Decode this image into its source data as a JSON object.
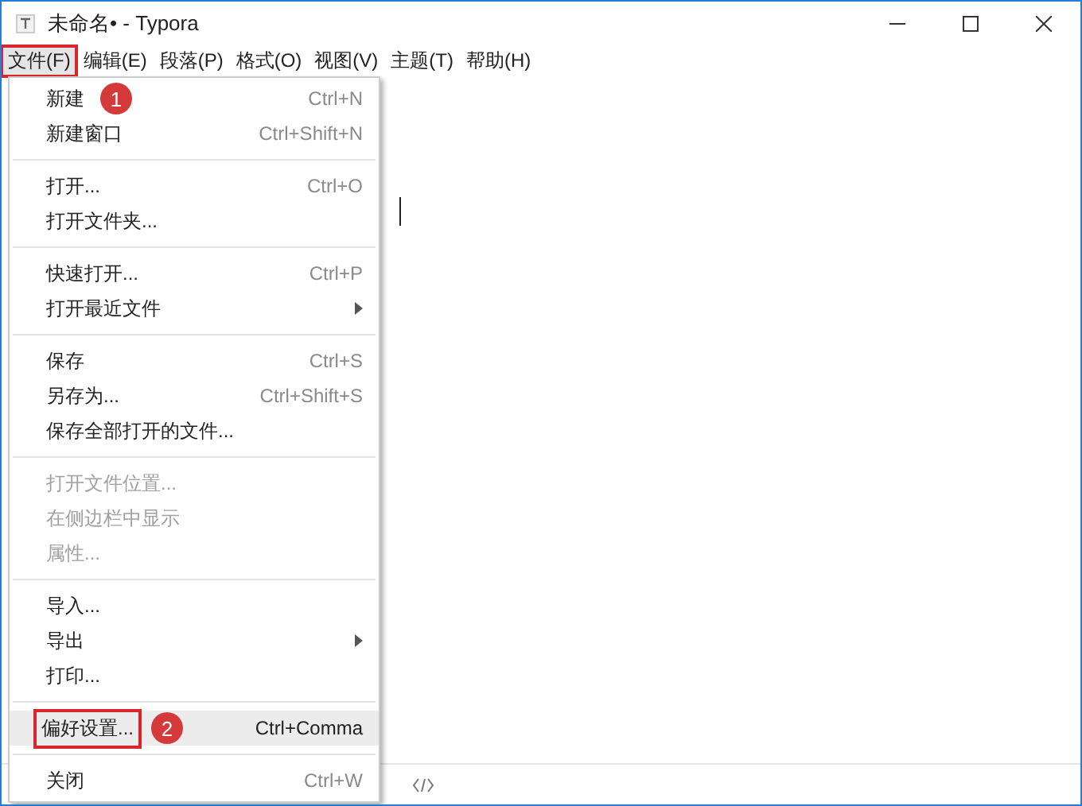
{
  "window": {
    "title": "未命名• - Typora"
  },
  "menu_bar": [
    {
      "label": "文件(F)",
      "selected": true,
      "highlighted": true
    },
    {
      "label": "编辑(E)",
      "selected": false,
      "highlighted": false
    },
    {
      "label": "段落(P)",
      "selected": false,
      "highlighted": false
    },
    {
      "label": "格式(O)",
      "selected": false,
      "highlighted": false
    },
    {
      "label": "视图(V)",
      "selected": false,
      "highlighted": false
    },
    {
      "label": "主题(T)",
      "selected": false,
      "highlighted": false
    },
    {
      "label": "帮助(H)",
      "selected": false,
      "highlighted": false
    }
  ],
  "file_menu": [
    {
      "kind": "item",
      "label": "新建",
      "shortcut": "Ctrl+N",
      "disabled": false,
      "submenu": false,
      "selected": false,
      "highlighted": false,
      "callout": "1"
    },
    {
      "kind": "item",
      "label": "新建窗口",
      "shortcut": "Ctrl+Shift+N",
      "disabled": false,
      "submenu": false,
      "selected": false,
      "highlighted": false
    },
    {
      "kind": "separator"
    },
    {
      "kind": "item",
      "label": "打开...",
      "shortcut": "Ctrl+O",
      "disabled": false,
      "submenu": false,
      "selected": false,
      "highlighted": false
    },
    {
      "kind": "item",
      "label": "打开文件夹...",
      "disabled": false,
      "submenu": false,
      "selected": false,
      "highlighted": false
    },
    {
      "kind": "separator"
    },
    {
      "kind": "item",
      "label": "快速打开...",
      "shortcut": "Ctrl+P",
      "disabled": false,
      "submenu": false,
      "selected": false,
      "highlighted": false
    },
    {
      "kind": "item",
      "label": "打开最近文件",
      "disabled": false,
      "submenu": true,
      "selected": false,
      "highlighted": false
    },
    {
      "kind": "separator"
    },
    {
      "kind": "item",
      "label": "保存",
      "shortcut": "Ctrl+S",
      "disabled": false,
      "submenu": false,
      "selected": false,
      "highlighted": false
    },
    {
      "kind": "item",
      "label": "另存为...",
      "shortcut": "Ctrl+Shift+S",
      "disabled": false,
      "submenu": false,
      "selected": false,
      "highlighted": false
    },
    {
      "kind": "item",
      "label": "保存全部打开的文件...",
      "disabled": false,
      "submenu": false,
      "selected": false,
      "highlighted": false
    },
    {
      "kind": "separator"
    },
    {
      "kind": "item",
      "label": "打开文件位置...",
      "disabled": true,
      "submenu": false,
      "selected": false,
      "highlighted": false
    },
    {
      "kind": "item",
      "label": "在侧边栏中显示",
      "disabled": true,
      "submenu": false,
      "selected": false,
      "highlighted": false
    },
    {
      "kind": "item",
      "label": "属性...",
      "disabled": true,
      "submenu": false,
      "selected": false,
      "highlighted": false
    },
    {
      "kind": "separator"
    },
    {
      "kind": "item",
      "label": "导入...",
      "disabled": false,
      "submenu": false,
      "selected": false,
      "highlighted": false
    },
    {
      "kind": "item",
      "label": "导出",
      "disabled": false,
      "submenu": true,
      "selected": false,
      "highlighted": false
    },
    {
      "kind": "item",
      "label": "打印...",
      "disabled": false,
      "submenu": false,
      "selected": false,
      "highlighted": false
    },
    {
      "kind": "separator"
    },
    {
      "kind": "item",
      "label": "偏好设置...",
      "shortcut": "Ctrl+Comma",
      "disabled": false,
      "submenu": false,
      "selected": true,
      "highlighted": true,
      "callout": "2"
    },
    {
      "kind": "separator"
    },
    {
      "kind": "item",
      "label": "关闭",
      "shortcut": "Ctrl+W",
      "disabled": false,
      "submenu": false,
      "selected": false,
      "highlighted": false
    }
  ]
}
